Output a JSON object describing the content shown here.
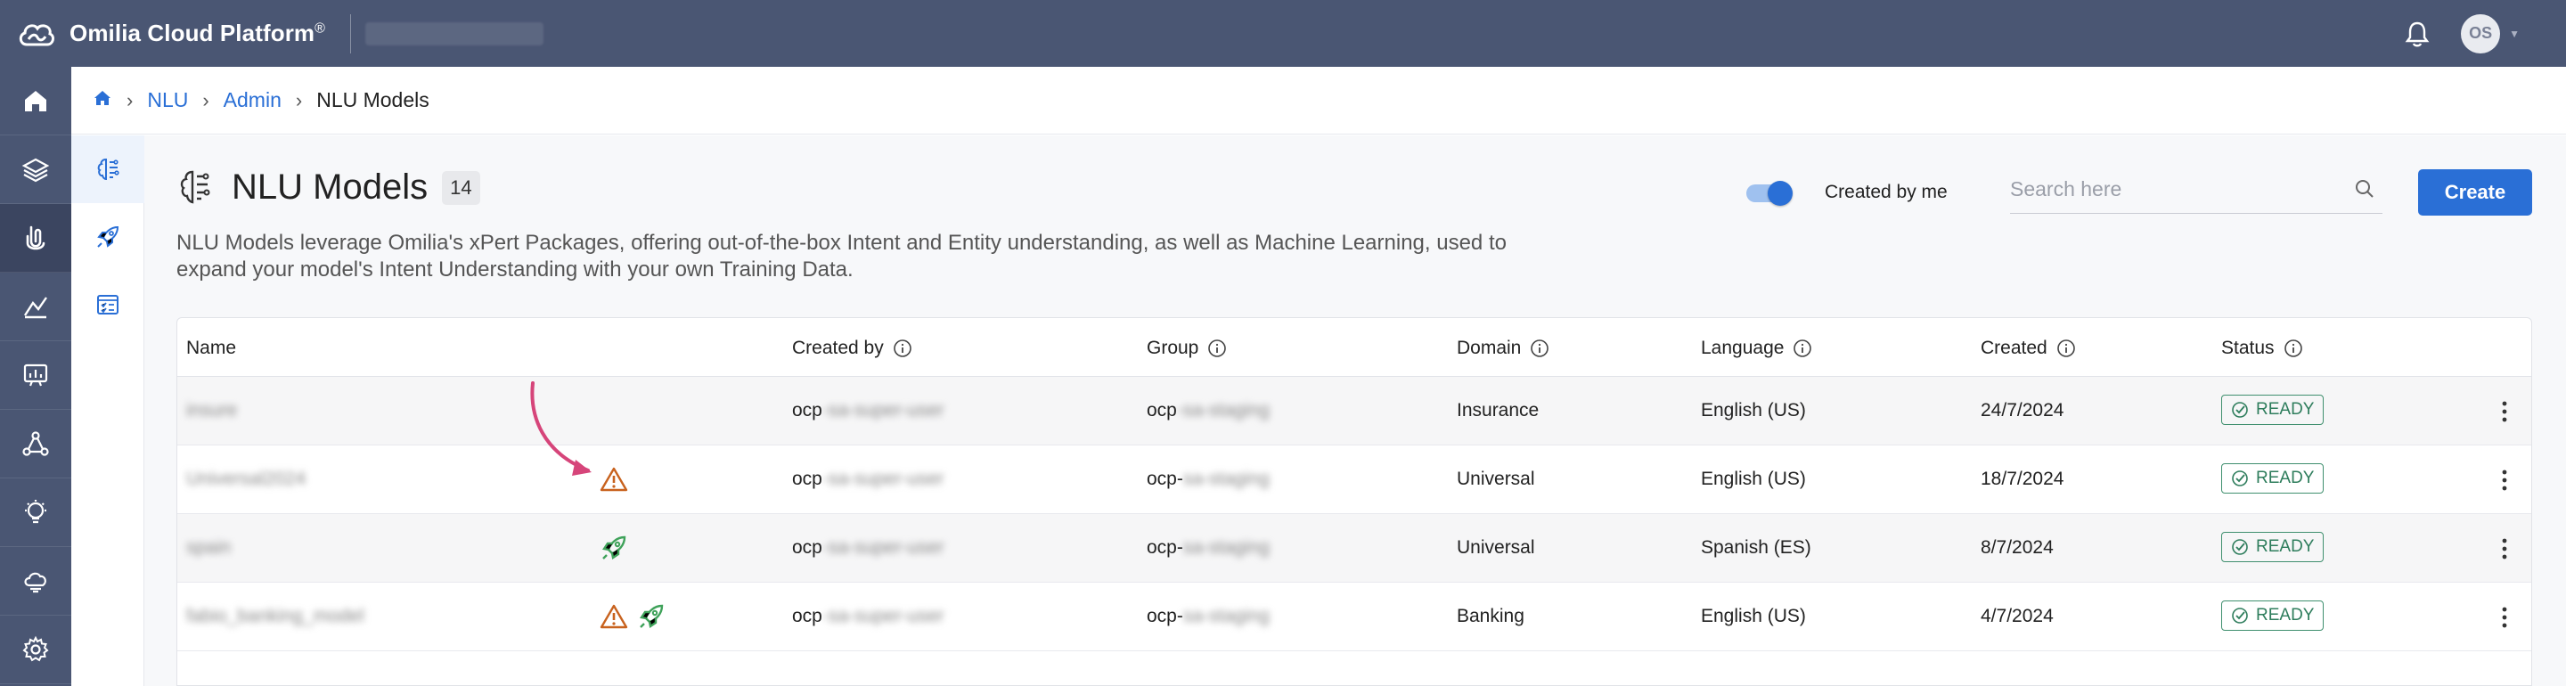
{
  "app": {
    "title": "Omilia Cloud Platform",
    "reg": "®",
    "user_initials": "OS"
  },
  "breadcrumb": {
    "items": [
      "NLU",
      "Admin"
    ],
    "current": "NLU Models"
  },
  "page": {
    "title": "NLU Models",
    "count": "14",
    "description": "NLU Models leverage Omilia's xPert Packages, offering out-of-the-box Intent and Entity understanding, as well as Machine Learning, used to expand your model's Intent Understanding with your own Training Data.",
    "toggle_label": "Created by me",
    "toggle_on": true,
    "search_placeholder": "Search here",
    "create_label": "Create"
  },
  "table": {
    "columns": [
      "Name",
      "Created by",
      "Group",
      "Domain",
      "Language",
      "Created",
      "Status"
    ],
    "rows": [
      {
        "name": "insure",
        "warning": false,
        "deployed": false,
        "created_by": "ocp",
        "created_by_hidden": "-sa-super-user",
        "group": "ocp",
        "group_hidden": "-sa-staging",
        "domain": "Insurance",
        "language": "English (US)",
        "created": "24/7/2024",
        "status": "READY"
      },
      {
        "name": "Universal2024",
        "warning": true,
        "deployed": false,
        "created_by": "ocp",
        "created_by_hidden": "-sa-super-user",
        "group": "ocp-",
        "group_hidden": "sa-staging",
        "domain": "Universal",
        "language": "English (US)",
        "created": "18/7/2024",
        "status": "READY"
      },
      {
        "name": "spain",
        "warning": false,
        "deployed": true,
        "created_by": "ocp",
        "created_by_hidden": "-sa-super-user",
        "group": "ocp-",
        "group_hidden": "sa-staging",
        "domain": "Universal",
        "language": "Spanish (ES)",
        "created": "8/7/2024",
        "status": "READY"
      },
      {
        "name": "fabio_banking_model",
        "warning": true,
        "deployed": true,
        "created_by": "ocp",
        "created_by_hidden": "-sa-super-user",
        "group": "ocp-",
        "group_hidden": "sa-staging",
        "domain": "Banking",
        "language": "English (US)",
        "created": "4/7/2024",
        "status": "READY"
      }
    ]
  },
  "nav": {
    "left": [
      "home-icon",
      "layers-icon",
      "nlu-icon",
      "analytics-icon",
      "reports-icon",
      "network-icon",
      "insights-icon",
      "cloud-icon",
      "settings-icon"
    ],
    "sub": [
      "brain-icon",
      "rocket-icon",
      "checklist-icon"
    ]
  },
  "colors": {
    "topbar": "#4a5673",
    "accent": "#2a6fd6",
    "ready": "#2e7d5c",
    "warning": "#c8621e",
    "deploy": "#3fa25a",
    "annotation": "#d6457a"
  }
}
